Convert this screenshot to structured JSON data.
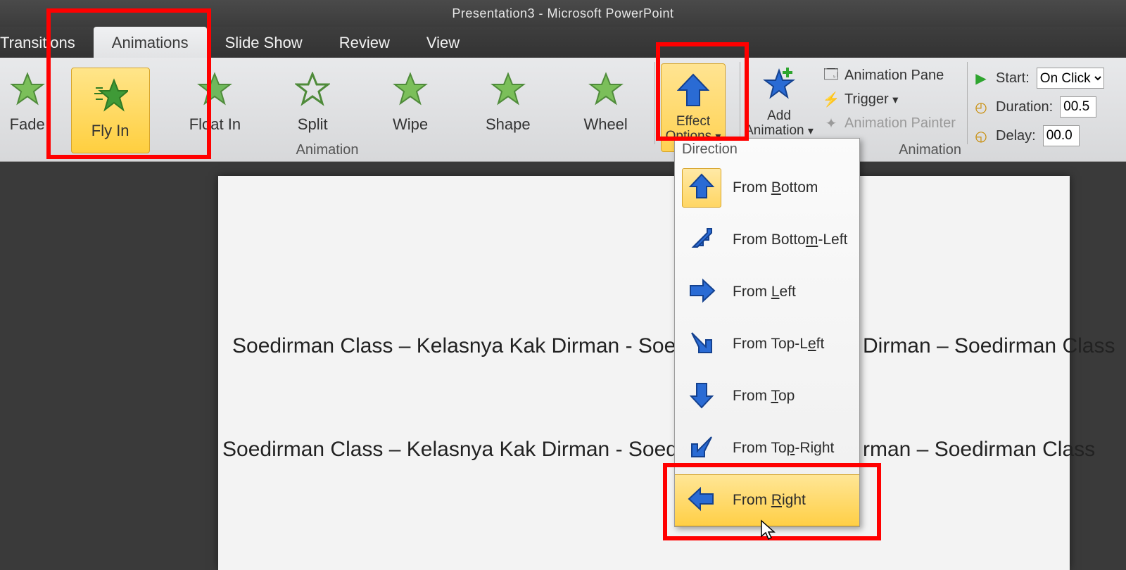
{
  "title": "Presentation3  -  Microsoft PowerPoint",
  "tabs": {
    "transitions": "Transitions",
    "animations": "Animations",
    "slideshow": "Slide Show",
    "review": "Review",
    "view": "View"
  },
  "gallery": {
    "fade": "Fade",
    "flyin": "Fly In",
    "floatin": "Float In",
    "split": "Split",
    "wipe": "Wipe",
    "shape": "Shape",
    "wheel": "Wheel",
    "group_label": "Animation"
  },
  "effect_options": {
    "line1": "Effect",
    "line2": "Options"
  },
  "add_animation": {
    "line1": "Add",
    "line2": "Animation"
  },
  "adv": {
    "pane": "Animation Pane",
    "trigger": "Trigger",
    "painter": "Animation Painter",
    "group_label": "Animation"
  },
  "timing": {
    "start_label": "Start:",
    "start_value": "On Click",
    "duration_label": "Duration:",
    "duration_value": "00.5",
    "delay_label": "Delay:",
    "delay_value": "00.0"
  },
  "menu": {
    "section": "Direction",
    "items": {
      "bottom_pre": "From ",
      "bottom_u": "B",
      "bottom_post": "ottom",
      "bottomleft_pre": "From Botto",
      "bottomleft_u": "m",
      "bottomleft_post": "-Left",
      "left_pre": "From ",
      "left_u": "L",
      "left_post": "eft",
      "topleft_pre": "From Top-L",
      "topleft_u": "e",
      "topleft_post": "ft",
      "top_pre": "From ",
      "top_u": "T",
      "top_post": "op",
      "topright_pre": "From To",
      "topright_u": "p",
      "topright_post": "-Right",
      "right_pre": "From ",
      "right_u": "R",
      "right_post": "ight"
    }
  },
  "slide": {
    "line1_left": "Soedirman Class – Kelasnya Kak Dirman - Soedirman",
    "line1_right": "Dirman – Soedirman Class",
    "line2_left": "Soedirman Class – Kelasnya Kak Dirman - Soedirman",
    "line2_right": "rman – Soedirman Class"
  }
}
